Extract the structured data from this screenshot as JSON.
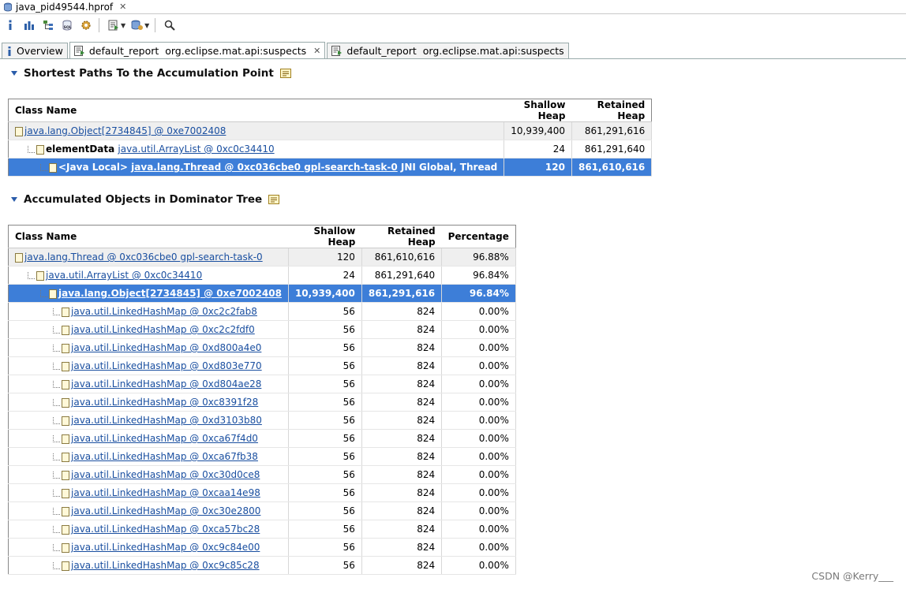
{
  "editor_tab": {
    "title": "java_pid49544.hprof",
    "close": "✕"
  },
  "view_tabs": [
    {
      "label": "Overview",
      "icon": "info-icon"
    },
    {
      "label": "default_report  org.eclipse.mat.api:suspects",
      "icon": "report-icon",
      "close": "✕"
    },
    {
      "label": "default_report  org.eclipse.mat.api:suspects",
      "icon": "report-icon"
    }
  ],
  "section1": {
    "title": "Shortest Paths To the Accumulation Point"
  },
  "table1": {
    "headers": [
      "Class Name",
      "Shallow Heap",
      "Retained Heap"
    ],
    "rows": [
      {
        "prefix": "",
        "link": "java.lang.Object[2734845] @ 0xe7002408",
        "suffix": "",
        "shallow": "10,939,400",
        "retained": "861,291,616"
      },
      {
        "prefix": "elementData ",
        "link": "java.util.ArrayList @ 0xc0c34410",
        "suffix": "",
        "shallow": "24",
        "retained": "861,291,640"
      },
      {
        "prefix": "<Java Local> ",
        "link": "java.lang.Thread @ 0xc036cbe0 gpl-search-task-0",
        "suffix": " JNI Global, Thread",
        "shallow": "120",
        "retained": "861,610,616"
      }
    ]
  },
  "section2": {
    "title": "Accumulated Objects in Dominator Tree"
  },
  "table2": {
    "headers": [
      "Class Name",
      "Shallow Heap",
      "Retained Heap",
      "Percentage"
    ],
    "rows": [
      {
        "link": "java.lang.Thread @ 0xc036cbe0 gpl-search-task-0",
        "shallow": "120",
        "retained": "861,610,616",
        "pct": "96.88%"
      },
      {
        "link": "java.util.ArrayList @ 0xc0c34410",
        "shallow": "24",
        "retained": "861,291,640",
        "pct": "96.84%"
      },
      {
        "link": "java.lang.Object[2734845] @ 0xe7002408",
        "shallow": "10,939,400",
        "retained": "861,291,616",
        "pct": "96.84%"
      },
      {
        "link": "java.util.LinkedHashMap @ 0xc2c2fab8",
        "shallow": "56",
        "retained": "824",
        "pct": "0.00%"
      },
      {
        "link": "java.util.LinkedHashMap @ 0xc2c2fdf0",
        "shallow": "56",
        "retained": "824",
        "pct": "0.00%"
      },
      {
        "link": "java.util.LinkedHashMap @ 0xd800a4e0",
        "shallow": "56",
        "retained": "824",
        "pct": "0.00%"
      },
      {
        "link": "java.util.LinkedHashMap @ 0xd803e770",
        "shallow": "56",
        "retained": "824",
        "pct": "0.00%"
      },
      {
        "link": "java.util.LinkedHashMap @ 0xd804ae28",
        "shallow": "56",
        "retained": "824",
        "pct": "0.00%"
      },
      {
        "link": "java.util.LinkedHashMap @ 0xc8391f28",
        "shallow": "56",
        "retained": "824",
        "pct": "0.00%"
      },
      {
        "link": "java.util.LinkedHashMap @ 0xd3103b80",
        "shallow": "56",
        "retained": "824",
        "pct": "0.00%"
      },
      {
        "link": "java.util.LinkedHashMap @ 0xca67f4d0",
        "shallow": "56",
        "retained": "824",
        "pct": "0.00%"
      },
      {
        "link": "java.util.LinkedHashMap @ 0xca67fb38",
        "shallow": "56",
        "retained": "824",
        "pct": "0.00%"
      },
      {
        "link": "java.util.LinkedHashMap @ 0xc30d0ce8",
        "shallow": "56",
        "retained": "824",
        "pct": "0.00%"
      },
      {
        "link": "java.util.LinkedHashMap @ 0xcaa14e98",
        "shallow": "56",
        "retained": "824",
        "pct": "0.00%"
      },
      {
        "link": "java.util.LinkedHashMap @ 0xc30e2800",
        "shallow": "56",
        "retained": "824",
        "pct": "0.00%"
      },
      {
        "link": "java.util.LinkedHashMap @ 0xca57bc28",
        "shallow": "56",
        "retained": "824",
        "pct": "0.00%"
      },
      {
        "link": "java.util.LinkedHashMap @ 0xc9c84e00",
        "shallow": "56",
        "retained": "824",
        "pct": "0.00%"
      },
      {
        "link": "java.util.LinkedHashMap @ 0xc9c85c28",
        "shallow": "56",
        "retained": "824",
        "pct": "0.00%"
      }
    ]
  },
  "watermark": "CSDN @Kerry___",
  "colors": {
    "selection": "#3d7ed8",
    "link": "#1a4fa0",
    "shade": "#efefef"
  }
}
